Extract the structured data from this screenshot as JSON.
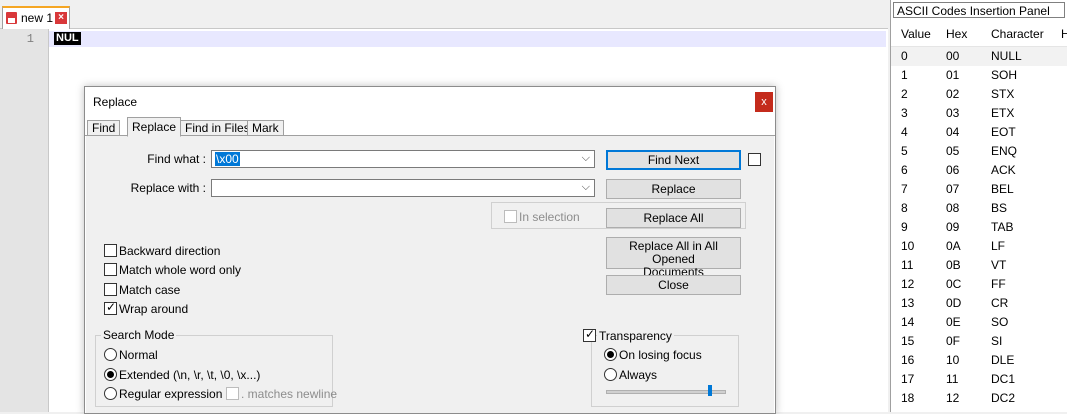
{
  "editor": {
    "tab": {
      "label": "new 1",
      "close_glyph": "×"
    },
    "line_number": "1",
    "content_token": "NUL"
  },
  "ascii_panel": {
    "title": "ASCII Codes Insertion Panel",
    "columns": [
      "Value",
      "Hex",
      "Character",
      "H"
    ],
    "rows": [
      [
        "0",
        "00",
        "NULL"
      ],
      [
        "1",
        "01",
        "SOH"
      ],
      [
        "2",
        "02",
        "STX"
      ],
      [
        "3",
        "03",
        "ETX"
      ],
      [
        "4",
        "04",
        "EOT"
      ],
      [
        "5",
        "05",
        "ENQ"
      ],
      [
        "6",
        "06",
        "ACK"
      ],
      [
        "7",
        "07",
        "BEL"
      ],
      [
        "8",
        "08",
        "BS"
      ],
      [
        "9",
        "09",
        "TAB"
      ],
      [
        "10",
        "0A",
        "LF"
      ],
      [
        "11",
        "0B",
        "VT"
      ],
      [
        "12",
        "0C",
        "FF"
      ],
      [
        "13",
        "0D",
        "CR"
      ],
      [
        "14",
        "0E",
        "SO"
      ],
      [
        "15",
        "0F",
        "SI"
      ],
      [
        "16",
        "10",
        "DLE"
      ],
      [
        "17",
        "11",
        "DC1"
      ],
      [
        "18",
        "12",
        "DC2"
      ]
    ]
  },
  "dialog": {
    "title": "Replace",
    "close_glyph": "x",
    "tabs": [
      "Find",
      "Replace",
      "Find in Files",
      "Mark"
    ],
    "active_tab": "Replace",
    "find_what": {
      "label": "Find what :",
      "value": "\\x00"
    },
    "replace_with": {
      "label": "Replace with :",
      "value": ""
    },
    "in_selection": "In selection",
    "buttons": {
      "find_next": "Find Next",
      "replace": "Replace",
      "replace_all": "Replace All",
      "replace_all_opened_1": "Replace All in All Opened",
      "replace_all_opened_2": "Documents",
      "close": "Close"
    },
    "options": {
      "backward": "Backward direction",
      "whole_word": "Match whole word only",
      "match_case": "Match case",
      "wrap_around": "Wrap around"
    },
    "search_mode": {
      "title": "Search Mode",
      "normal": "Normal",
      "extended": "Extended (\\n, \\r, \\t, \\0, \\x...)",
      "regex": "Regular expression",
      "matches_newline": ". matches newline"
    },
    "transparency": {
      "title": "Transparency",
      "on_losing_focus": "On losing focus",
      "always": "Always",
      "slider_level": 0.88
    }
  },
  "colors": {
    "accent": "#0078d7",
    "close_red": "#c42b1c",
    "current_line": "#e8e8ff"
  }
}
